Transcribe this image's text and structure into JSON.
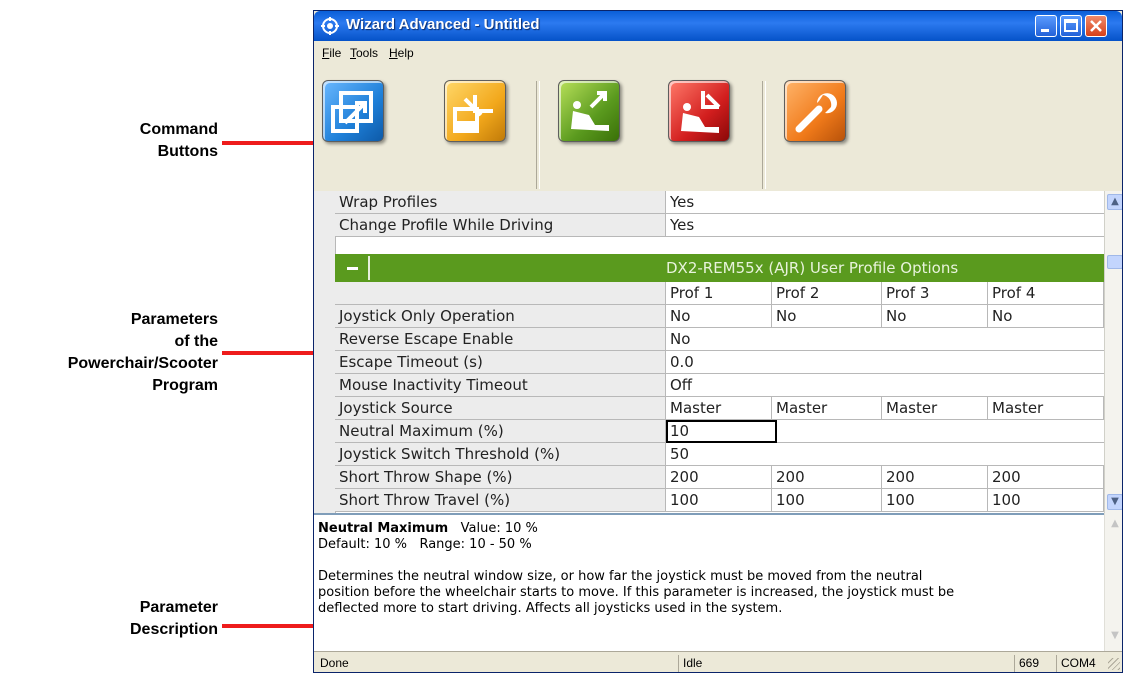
{
  "annotations": {
    "command": [
      "Command",
      "Buttons"
    ],
    "parameters": [
      "Parameters",
      "of the",
      "Powerchair/Scooter",
      "Program"
    ],
    "description": [
      "Parameter",
      "Description"
    ]
  },
  "window": {
    "title": "Wizard Advanced - Untitled"
  },
  "menu": [
    "File",
    "Tools",
    "Help"
  ],
  "toolbar": {
    "buttons": [
      {
        "icon": "read-from-system-icon",
        "color": "#1e7fd8"
      },
      {
        "icon": "write-to-system-icon",
        "color": "#f2a81c"
      },
      {
        "icon": "read-from-chair-icon",
        "color": "#5a9a1e"
      },
      {
        "icon": "write-to-chair-icon",
        "color": "#d21e1e"
      },
      {
        "icon": "wrench-icon",
        "color": "#f07a1a"
      }
    ]
  },
  "grid": {
    "top_rows": [
      {
        "label": "Wrap Profiles",
        "value": "Yes"
      },
      {
        "label": "Change Profile While Driving",
        "value": "Yes"
      }
    ],
    "group_title": "DX2-REM55x (AJR) User Profile Options",
    "profiles": [
      "Prof 1",
      "Prof 2",
      "Prof 3",
      "Prof 4"
    ],
    "rows": [
      {
        "label": "Joystick Only Operation",
        "values": [
          "No",
          "No",
          "No",
          "No"
        ]
      },
      {
        "label": "Reverse Escape Enable",
        "values": [
          "No"
        ]
      },
      {
        "label": "Escape Timeout (s)",
        "values": [
          "0.0"
        ]
      },
      {
        "label": "Mouse Inactivity Timeout",
        "values": [
          "Off"
        ]
      },
      {
        "label": "Joystick Source",
        "values": [
          "Master",
          "Master",
          "Master",
          "Master"
        ]
      },
      {
        "label": "Neutral Maximum (%)",
        "values": [
          "10"
        ]
      },
      {
        "label": "Joystick Switch Threshold (%)",
        "values": [
          "50"
        ]
      },
      {
        "label": "Short Throw Shape (%)",
        "values": [
          "200",
          "200",
          "200",
          "200"
        ]
      },
      {
        "label": "Short Throw Travel (%)",
        "values": [
          "100",
          "100",
          "100",
          "100"
        ]
      }
    ]
  },
  "description": {
    "name": "Neutral Maximum",
    "value_text": "Value: 10 %",
    "default_text": "Default: 10 %",
    "range_text": "Range: 10 - 50 %",
    "body_1": "Determines the neutral window size, or how far the joystick must be moved from the neutral",
    "body_2": "position before the wheelchair starts to move. If this parameter is increased, the joystick must be",
    "body_3": "deflected more to start driving. Affects all joysticks used in the system."
  },
  "status": {
    "left": "Done",
    "middle": "Idle",
    "count": "669",
    "port": "COM4"
  }
}
